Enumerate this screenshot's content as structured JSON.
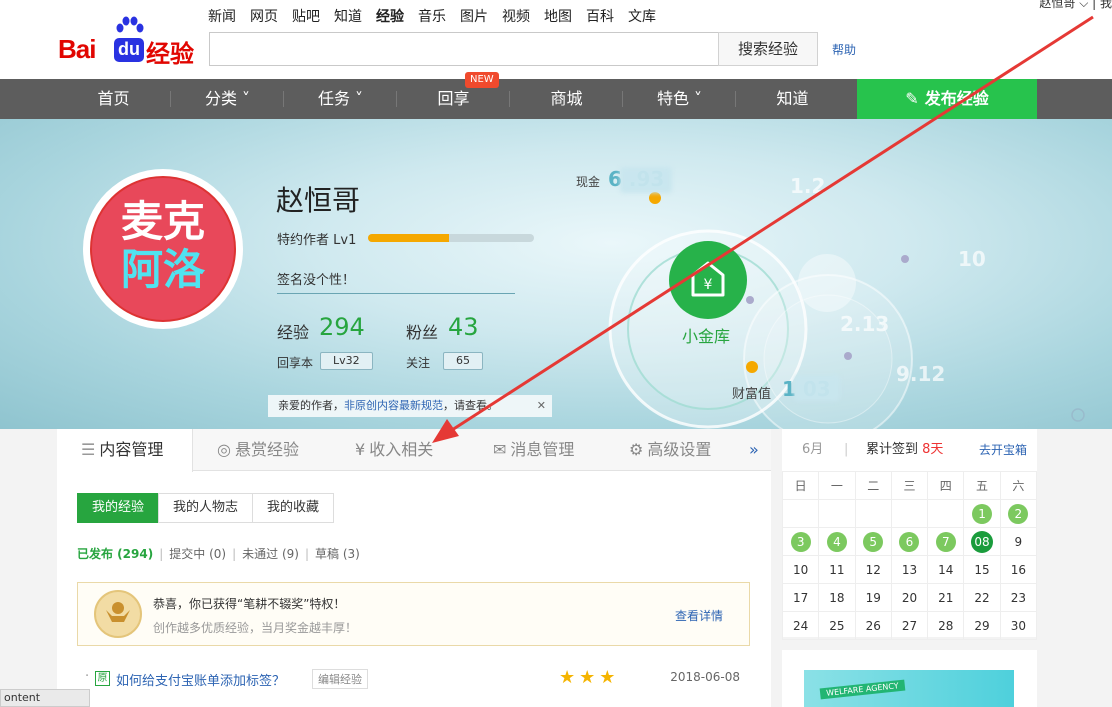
{
  "header": {
    "logo": {
      "bai": "Bai",
      "du": "du",
      "jingyan": "经验"
    },
    "topnav": [
      "新闻",
      "网页",
      "贴吧",
      "知道",
      "经验",
      "音乐",
      "图片",
      "视频",
      "地图",
      "百科",
      "文库"
    ],
    "active_topnav": "经验",
    "user": "赵恒哥 ⌵ | 我",
    "search_value": "",
    "search_button": "搜索经验",
    "help": "帮助"
  },
  "mainnav": {
    "items": [
      "首页",
      "分类 ˅",
      "任务 ˅",
      "回享",
      "商城",
      "特色 ˅",
      "知道"
    ],
    "new_badge": "NEW",
    "publish": "发布经验"
  },
  "profile": {
    "avatar_line1": "麦克",
    "avatar_line2": "阿洛",
    "name": "赵恒哥",
    "rank": "特约作者 Lv1",
    "level_progress": 0.49,
    "signature": "签名没个性！",
    "exp_label": "经验",
    "exp_value": "294",
    "fans_label": "粉丝",
    "fans_value": "43",
    "huixiang_label": "回享本",
    "huixiang_value": "Lv32",
    "follow_label": "关注",
    "follow_value": "65",
    "notice_prefix": "亲爱的作者，",
    "notice_link": "非原创内容最新规范",
    "notice_suffix": "，请查看。",
    "notice_close": "✕"
  },
  "treasury": {
    "cash_label": "现金",
    "cash_value": "6   .93",
    "wealth_label": "财富值",
    "wealth_value": "1     03",
    "center_label": "小金库",
    "right_values": [
      "1.2",
      "10",
      "2.13",
      "9.12"
    ]
  },
  "content": {
    "tabs": [
      "内容管理",
      "悬赏经验",
      "收入相关",
      "消息管理",
      "高级设置"
    ],
    "tab_more": "»",
    "subtabs": [
      "我的经验",
      "我的人物志",
      "我的收藏"
    ],
    "filters": {
      "published": "已发布 (294)",
      "submitting": "提交中 (0)",
      "rejected": "未通过 (9)",
      "draft": "草稿 (3)"
    },
    "award": {
      "line1": "恭喜，你已获得“笔耕不辍奖”特权！",
      "line2": "创作越多优质经验，当月奖金越丰厚！",
      "more": "查看详情"
    },
    "rows": [
      {
        "tag": "原",
        "title": "如何给支付宝账单添加标签？",
        "edit": "编辑经验",
        "stars": 3,
        "date": "2018-06-08"
      }
    ]
  },
  "calendar": {
    "month": "6月",
    "sep": "|",
    "checkin_prefix": "累计签到",
    "checkin_days": "8天",
    "treasure": "去开宝箱",
    "weekdays": [
      "日",
      "一",
      "二",
      "三",
      "四",
      "五",
      "六"
    ],
    "days": [
      "",
      "",
      "",
      "",
      "",
      "1",
      "2",
      "3",
      "4",
      "5",
      "6",
      "7",
      "08",
      "9",
      "10",
      "11",
      "12",
      "13",
      "14",
      "15",
      "16",
      "17",
      "18",
      "19",
      "20",
      "21",
      "22",
      "23",
      "24",
      "25",
      "26",
      "27",
      "28",
      "29",
      "30"
    ],
    "checked": [
      "1",
      "2",
      "3",
      "4",
      "5",
      "6",
      "7"
    ],
    "today": "08"
  },
  "ad": {
    "tag": "WELFARE AGENCY"
  },
  "statusbar": "ontent",
  "colors": {
    "green": "#27a53f",
    "publish_green": "#27c34d",
    "nav_gray": "#5d5d5d",
    "link_blue": "#2d64b3",
    "arrow_red": "#e53935"
  }
}
